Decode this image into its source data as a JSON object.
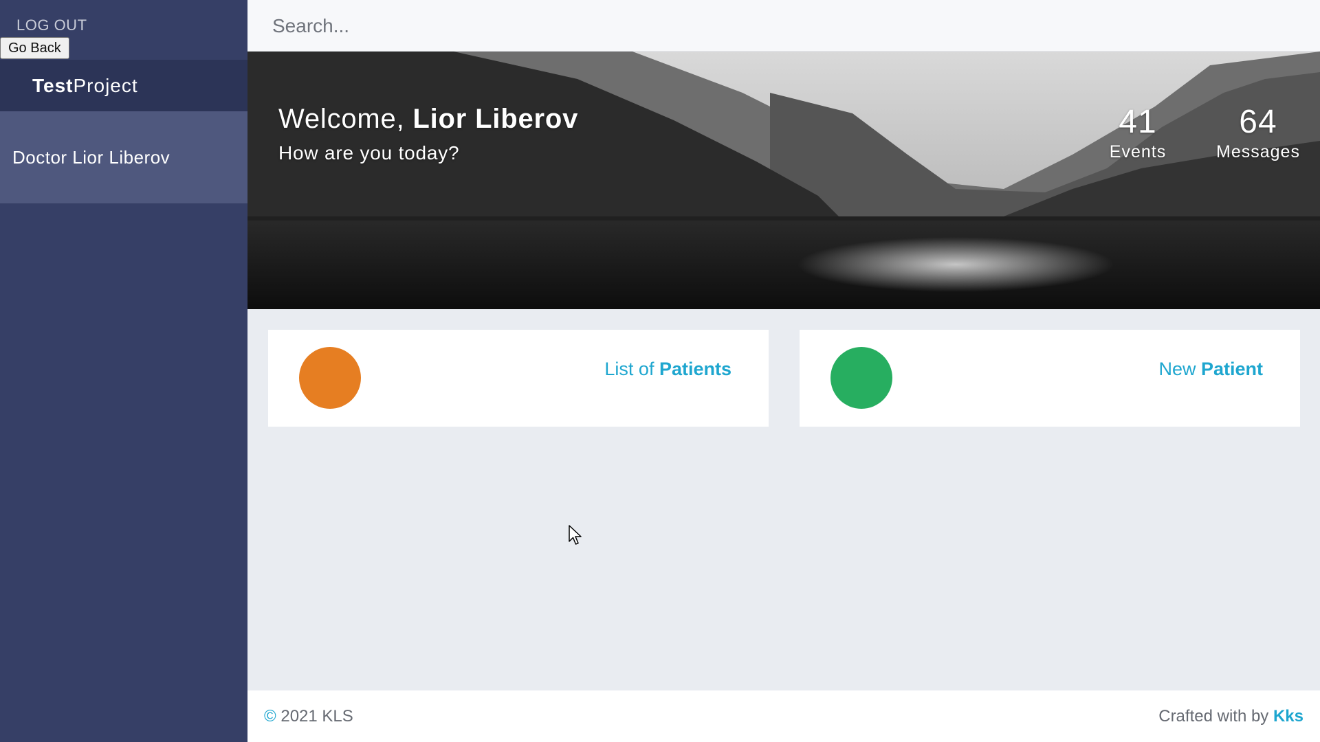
{
  "sidebar": {
    "logout_label": "LOG OUT",
    "go_back_label": "Go Back",
    "brand_bold": "Test",
    "brand_regular": "Project",
    "user_name": "Doctor Lior Liberov"
  },
  "topbar": {
    "search_placeholder": "Search..."
  },
  "hero": {
    "welcome_prefix": "Welcome, ",
    "welcome_name": "Lior Liberov",
    "subtitle": "How are you today?",
    "stats": [
      {
        "value": "41",
        "label": "Events"
      },
      {
        "value": "64",
        "label": "Messages"
      }
    ]
  },
  "cards": [
    {
      "title_prefix": "List of ",
      "title_bold": "Patients",
      "color": "#e67e22"
    },
    {
      "title_prefix": "New ",
      "title_bold": "Patient",
      "color": "#27ae60"
    }
  ],
  "footer": {
    "copyright_symbol": "©",
    "copyright_text": " 2021 KLS",
    "crafted_prefix": "Crafted with by ",
    "crafted_brand": "Kks"
  },
  "colors": {
    "sidebar_bg": "#363f66",
    "brand_bg": "#2c3457",
    "user_block_bg": "#4f587e",
    "accent": "#1ea6cf",
    "content_bg": "#e9ecf1"
  },
  "icons": {
    "cursor": "mouse-pointer-icon"
  }
}
